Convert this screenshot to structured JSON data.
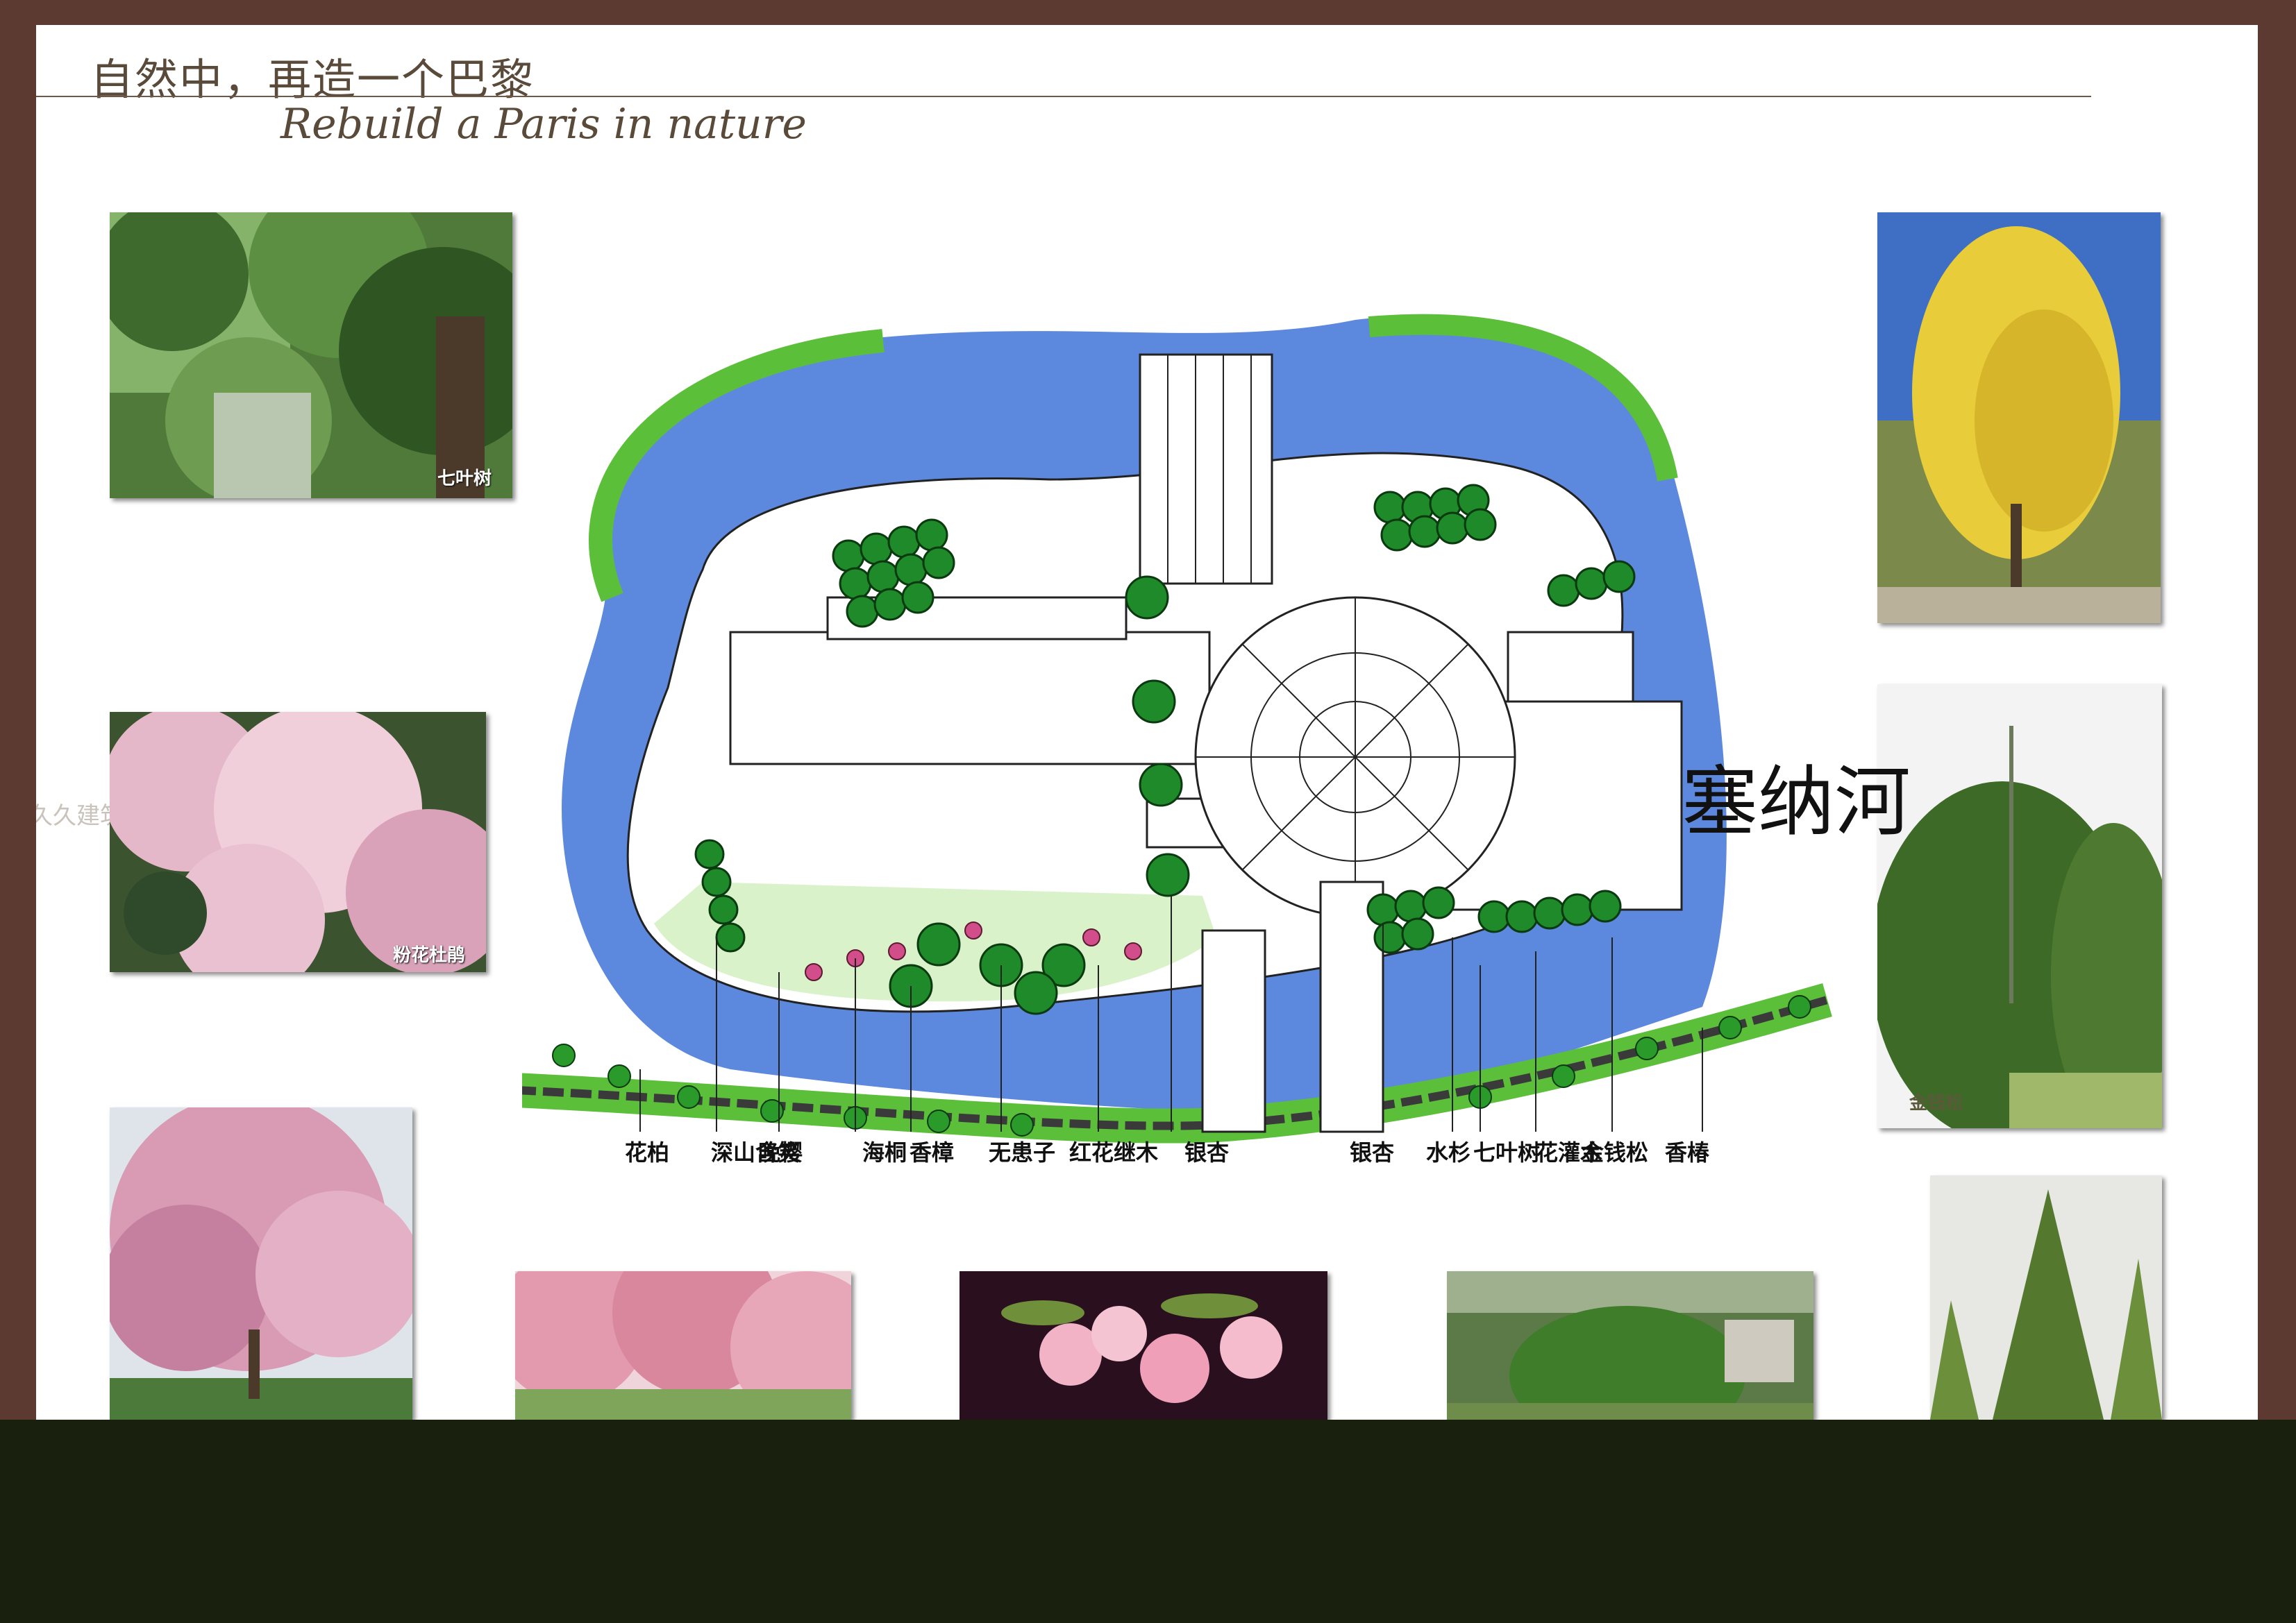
{
  "header": {
    "title_cn": "自然中，再造一个巴黎",
    "title_en": "Rebuild a Paris in nature"
  },
  "watermark": "久久建筑",
  "photos": {
    "qiyeshu": "七叶树",
    "fenhuadujuan": "粉花杜鹃",
    "jinqiansong": "金钱松"
  },
  "plan": {
    "river_label": "塞纳河",
    "legend": [
      "花柏",
      "深山含笑",
      "晚樱",
      "海桐",
      "香樟",
      "无患子",
      "红花继木",
      "银杏",
      "银杏",
      "水杉",
      "七叶树",
      "花灌木",
      "金钱松",
      "香椿"
    ]
  },
  "colors": {
    "frame": "#5c3a32",
    "footer": "#19200d",
    "water": "#3f74d8",
    "grass": "#5cbf3a"
  }
}
